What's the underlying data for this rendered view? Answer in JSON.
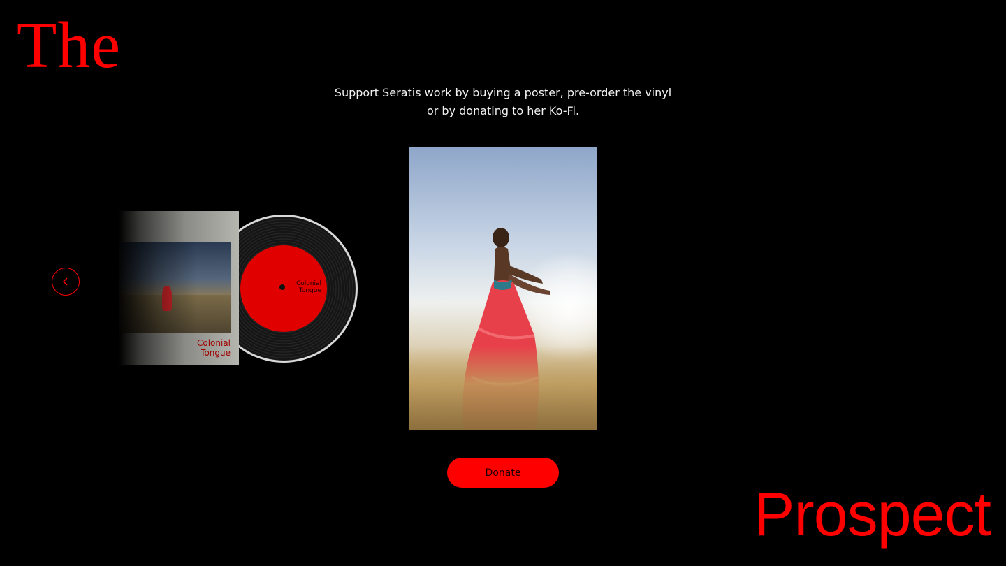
{
  "brand": {
    "word_top": "The",
    "word_bottom": "Prospect",
    "color": "#ff0000"
  },
  "intro": {
    "line1": "Support Seratis work by buying a poster, pre-order the vinyl",
    "line2": "or by donating to her Ko-Fi."
  },
  "carousel": {
    "prev_icon": "chevron-left-icon",
    "vinyl": {
      "sleeve_title_line1": "Colonial",
      "sleeve_title_line2": "Tongue",
      "label_title_line1": "Colonial",
      "label_title_line2": "Tongue"
    }
  },
  "poster": {
    "image": "dancer-in-red-dress-in-field"
  },
  "actions": {
    "donate_label": "Donate",
    "accent": "#ff0000"
  }
}
